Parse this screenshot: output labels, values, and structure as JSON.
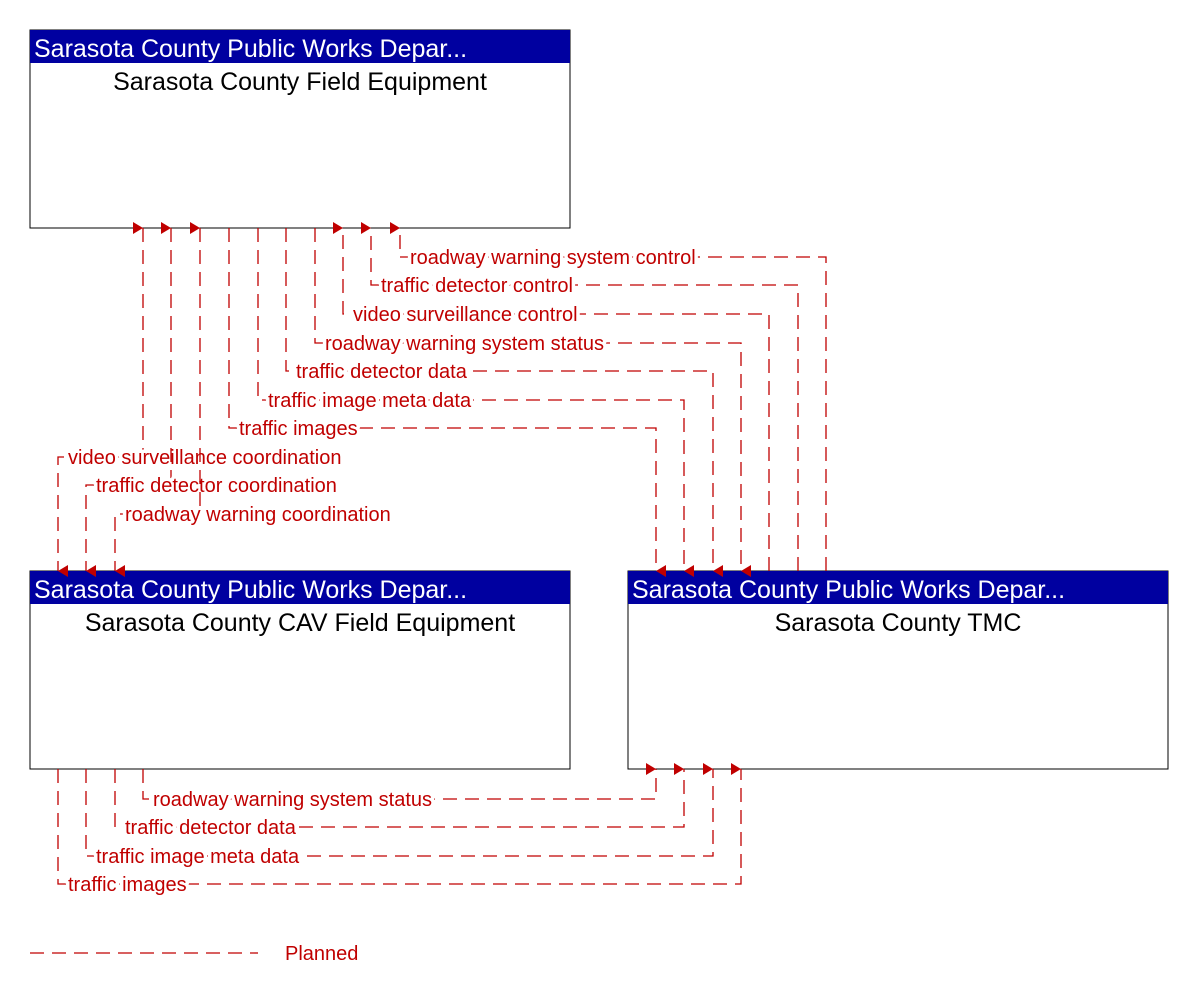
{
  "colors": {
    "header": "#0000a0",
    "flow": "#c00000",
    "box_border": "#000000"
  },
  "boxes": [
    {
      "id": "field",
      "owner": "Sarasota County Public Works Depar...",
      "name": "Sarasota County Field Equipment"
    },
    {
      "id": "cav",
      "owner": "Sarasota County Public Works Depar...",
      "name": "Sarasota County CAV Field Equipment"
    },
    {
      "id": "tmc",
      "owner": "Sarasota County Public Works Depar...",
      "name": "Sarasota County TMC"
    }
  ],
  "flows": [
    {
      "label": "roadway warning system control",
      "from": "tmc",
      "to": "field",
      "status": "Planned"
    },
    {
      "label": "traffic detector control",
      "from": "tmc",
      "to": "field",
      "status": "Planned"
    },
    {
      "label": "video surveillance control",
      "from": "tmc",
      "to": "field",
      "status": "Planned"
    },
    {
      "label": "roadway warning system status",
      "from": "field",
      "to": "tmc",
      "status": "Planned"
    },
    {
      "label": "traffic detector data",
      "from": "field",
      "to": "tmc",
      "status": "Planned"
    },
    {
      "label": "traffic image meta data",
      "from": "field",
      "to": "tmc",
      "status": "Planned"
    },
    {
      "label": "traffic images",
      "from": "field",
      "to": "tmc",
      "status": "Planned"
    },
    {
      "label": "video surveillance coordination",
      "from": "field",
      "to": "cav",
      "bidirectional": true,
      "status": "Planned"
    },
    {
      "label": "traffic detector coordination",
      "from": "field",
      "to": "cav",
      "bidirectional": true,
      "status": "Planned"
    },
    {
      "label": "roadway warning coordination",
      "from": "field",
      "to": "cav",
      "bidirectional": true,
      "status": "Planned"
    },
    {
      "label": "roadway warning system status",
      "from": "cav",
      "to": "tmc",
      "status": "Planned"
    },
    {
      "label": "traffic detector data",
      "from": "cav",
      "to": "tmc",
      "status": "Planned"
    },
    {
      "label": "traffic image meta data",
      "from": "cav",
      "to": "tmc",
      "status": "Planned"
    },
    {
      "label": "traffic images",
      "from": "cav",
      "to": "tmc",
      "status": "Planned"
    }
  ],
  "legend": {
    "label": "Planned"
  }
}
